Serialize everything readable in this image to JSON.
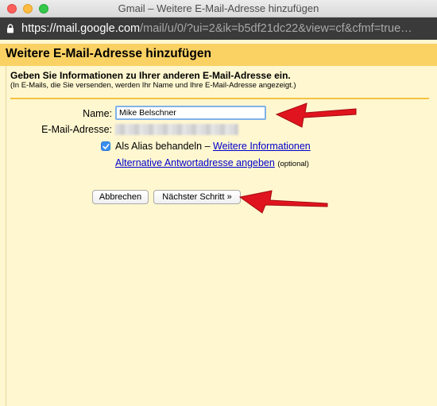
{
  "window": {
    "title": "Gmail – Weitere E-Mail-Adresse hinzufügen",
    "controls": [
      "close",
      "minimize",
      "maximize"
    ]
  },
  "urlbar": {
    "scheme": "https://",
    "host": "mail.google.com",
    "path": "/mail/u/0/?ui=2&ik=b5df21dc22&view=cf&cfmf=true…",
    "icon": "lock-icon"
  },
  "dialog": {
    "title": "Weitere E-Mail-Adresse hinzufügen",
    "heading": "Geben Sie Informationen zu Ihrer anderen E-Mail-Adresse ein.",
    "note": "(In E-Mails, die Sie versenden, werden Ihr Name und Ihre E-Mail-Adresse angezeigt.)",
    "name_label": "Name:",
    "name_value": "Mike Belschner",
    "email_label": "E-Mail-Adresse:",
    "email_value_redacted": true,
    "alias_checked": true,
    "alias_label": "Als Alias behandeln – ",
    "alias_link": "Weitere Informationen",
    "reply_link": "Alternative Antwortadresse angeben",
    "reply_optional": "(optional)",
    "cancel_button": "Abbrechen",
    "next_button": "Nächster Schritt »"
  },
  "colors": {
    "header": "#fad163",
    "background": "#fff7d0",
    "divider": "#f5c242",
    "link": "#0000cc",
    "annotation_arrow": "#e0141e",
    "checkbox": "#3b8ef0"
  }
}
